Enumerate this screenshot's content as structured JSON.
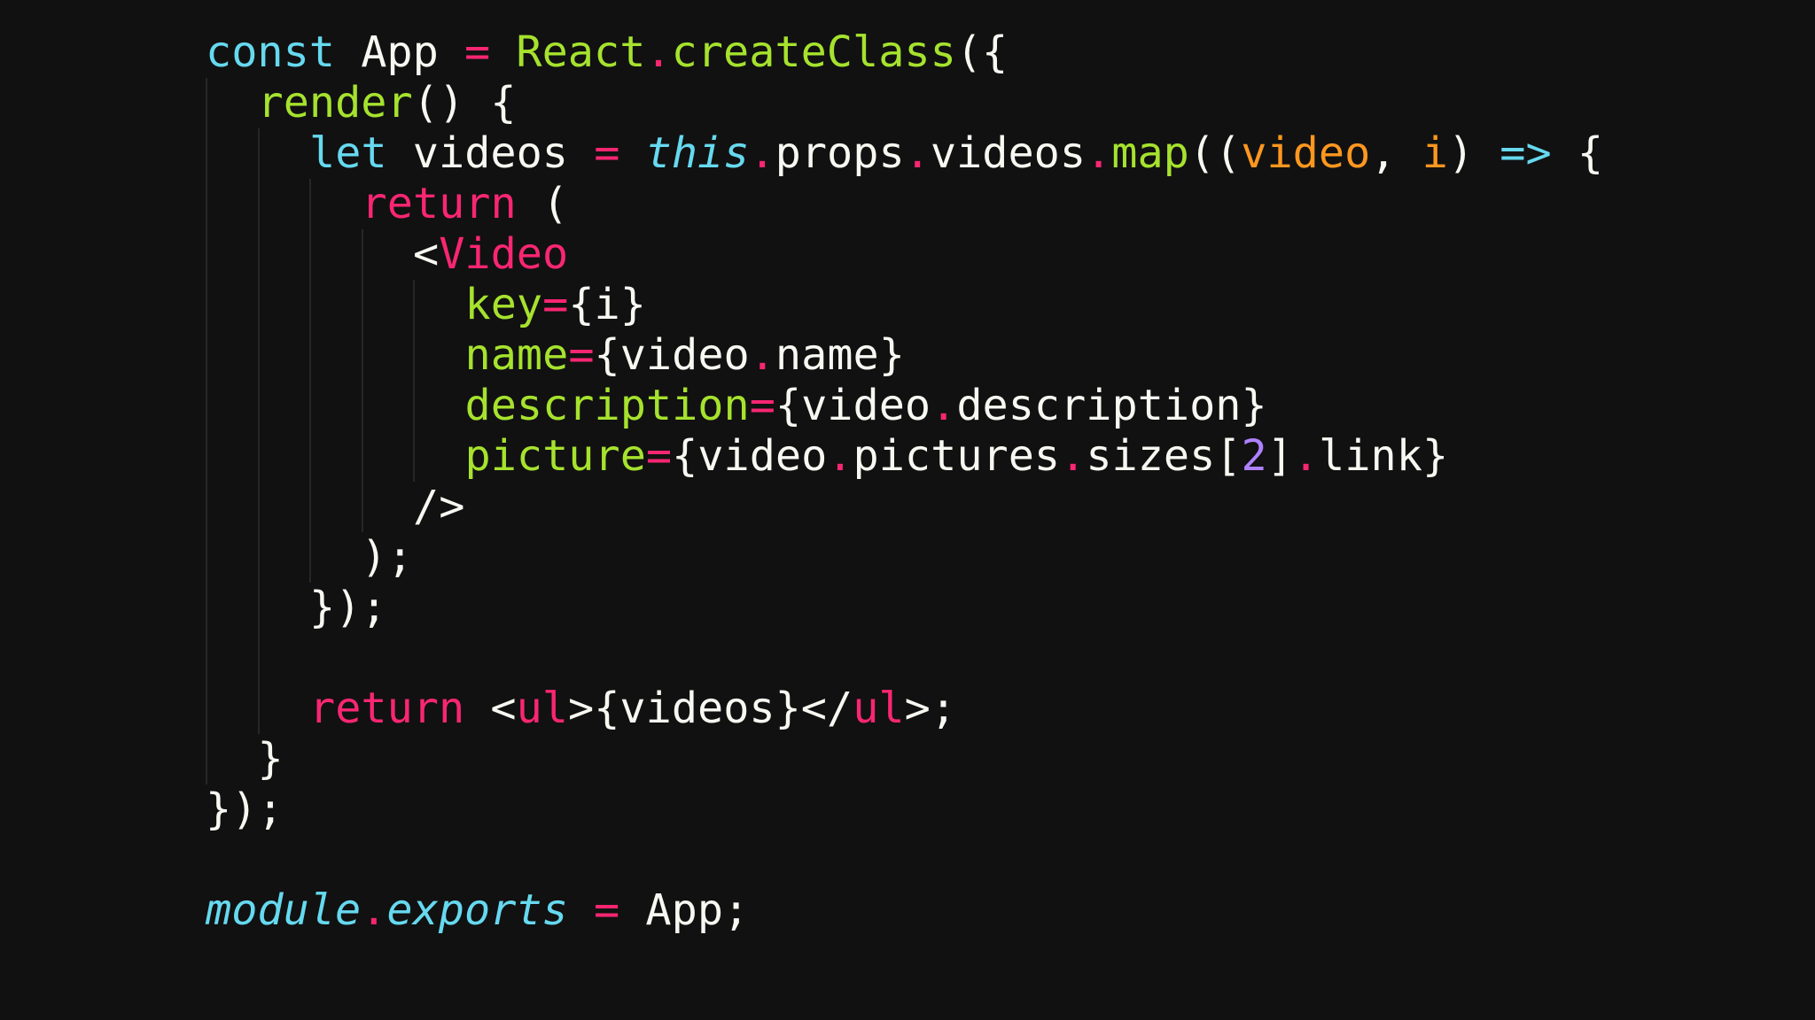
{
  "colors": {
    "background": "#111111",
    "plain": "#f8f8f2",
    "keyword_blue": "#66d9ef",
    "keyword_pink": "#f92672",
    "function_green": "#a6e22e",
    "parameter_orange": "#fd971f",
    "number_purple": "#ae81ff",
    "indent_guide": "#272727"
  },
  "code": {
    "lines": [
      {
        "indent": 0,
        "tokens": [
          {
            "t": "const",
            "c": "kw-blue"
          },
          {
            "t": " App ",
            "c": "plain"
          },
          {
            "t": "=",
            "c": "kw-pink"
          },
          {
            "t": " ",
            "c": "plain"
          },
          {
            "t": "React",
            "c": "fn-green"
          },
          {
            "t": ".",
            "c": "kw-pink"
          },
          {
            "t": "createClass",
            "c": "fn-green"
          },
          {
            "t": "({",
            "c": "plain"
          }
        ]
      },
      {
        "indent": 1,
        "tokens": [
          {
            "t": "render",
            "c": "fn-green"
          },
          {
            "t": "() {",
            "c": "plain"
          }
        ]
      },
      {
        "indent": 2,
        "tokens": [
          {
            "t": "let",
            "c": "kw-blue"
          },
          {
            "t": " videos ",
            "c": "plain"
          },
          {
            "t": "=",
            "c": "kw-pink"
          },
          {
            "t": " ",
            "c": "plain"
          },
          {
            "t": "this",
            "c": "kw-blue italic"
          },
          {
            "t": ".",
            "c": "kw-pink"
          },
          {
            "t": "props",
            "c": "plain"
          },
          {
            "t": ".",
            "c": "kw-pink"
          },
          {
            "t": "videos",
            "c": "plain"
          },
          {
            "t": ".",
            "c": "kw-pink"
          },
          {
            "t": "map",
            "c": "fn-green"
          },
          {
            "t": "((",
            "c": "plain"
          },
          {
            "t": "video",
            "c": "param-orange"
          },
          {
            "t": ", ",
            "c": "plain"
          },
          {
            "t": "i",
            "c": "param-orange"
          },
          {
            "t": ") ",
            "c": "plain"
          },
          {
            "t": "=>",
            "c": "kw-blue"
          },
          {
            "t": " {",
            "c": "plain"
          }
        ]
      },
      {
        "indent": 3,
        "tokens": [
          {
            "t": "return",
            "c": "kw-pink"
          },
          {
            "t": " (",
            "c": "plain"
          }
        ]
      },
      {
        "indent": 4,
        "tokens": [
          {
            "t": "<",
            "c": "plain"
          },
          {
            "t": "Video",
            "c": "kw-pink"
          }
        ]
      },
      {
        "indent": 5,
        "tokens": [
          {
            "t": "key",
            "c": "fn-green"
          },
          {
            "t": "=",
            "c": "kw-pink"
          },
          {
            "t": "{i}",
            "c": "plain"
          }
        ]
      },
      {
        "indent": 5,
        "tokens": [
          {
            "t": "name",
            "c": "fn-green"
          },
          {
            "t": "=",
            "c": "kw-pink"
          },
          {
            "t": "{video",
            "c": "plain"
          },
          {
            "t": ".",
            "c": "kw-pink"
          },
          {
            "t": "name}",
            "c": "plain"
          }
        ]
      },
      {
        "indent": 5,
        "tokens": [
          {
            "t": "description",
            "c": "fn-green"
          },
          {
            "t": "=",
            "c": "kw-pink"
          },
          {
            "t": "{video",
            "c": "plain"
          },
          {
            "t": ".",
            "c": "kw-pink"
          },
          {
            "t": "description}",
            "c": "plain"
          }
        ]
      },
      {
        "indent": 5,
        "tokens": [
          {
            "t": "picture",
            "c": "fn-green"
          },
          {
            "t": "=",
            "c": "kw-pink"
          },
          {
            "t": "{video",
            "c": "plain"
          },
          {
            "t": ".",
            "c": "kw-pink"
          },
          {
            "t": "pictures",
            "c": "plain"
          },
          {
            "t": ".",
            "c": "kw-pink"
          },
          {
            "t": "sizes[",
            "c": "plain"
          },
          {
            "t": "2",
            "c": "num-purple"
          },
          {
            "t": "]",
            "c": "plain"
          },
          {
            "t": ".",
            "c": "kw-pink"
          },
          {
            "t": "link}",
            "c": "plain"
          }
        ]
      },
      {
        "indent": 4,
        "tokens": [
          {
            "t": "/>",
            "c": "plain"
          }
        ]
      },
      {
        "indent": 3,
        "tokens": [
          {
            "t": ");",
            "c": "plain"
          }
        ]
      },
      {
        "indent": 2,
        "tokens": [
          {
            "t": "});",
            "c": "plain"
          }
        ]
      },
      {
        "indent": 2,
        "tokens": []
      },
      {
        "indent": 2,
        "tokens": [
          {
            "t": "return",
            "c": "kw-pink"
          },
          {
            "t": " <",
            "c": "plain"
          },
          {
            "t": "ul",
            "c": "kw-pink"
          },
          {
            "t": ">{videos}</",
            "c": "plain"
          },
          {
            "t": "ul",
            "c": "kw-pink"
          },
          {
            "t": ">;",
            "c": "plain"
          }
        ]
      },
      {
        "indent": 1,
        "tokens": [
          {
            "t": "}",
            "c": "plain"
          }
        ]
      },
      {
        "indent": 0,
        "tokens": [
          {
            "t": "});",
            "c": "plain"
          }
        ]
      },
      {
        "indent": 0,
        "tokens": []
      },
      {
        "indent": 0,
        "tokens": [
          {
            "t": "module",
            "c": "kw-blue italic"
          },
          {
            "t": ".",
            "c": "kw-pink"
          },
          {
            "t": "exports",
            "c": "kw-blue italic"
          },
          {
            "t": " ",
            "c": "plain"
          },
          {
            "t": "=",
            "c": "kw-pink"
          },
          {
            "t": " App;",
            "c": "plain"
          }
        ]
      }
    ]
  }
}
